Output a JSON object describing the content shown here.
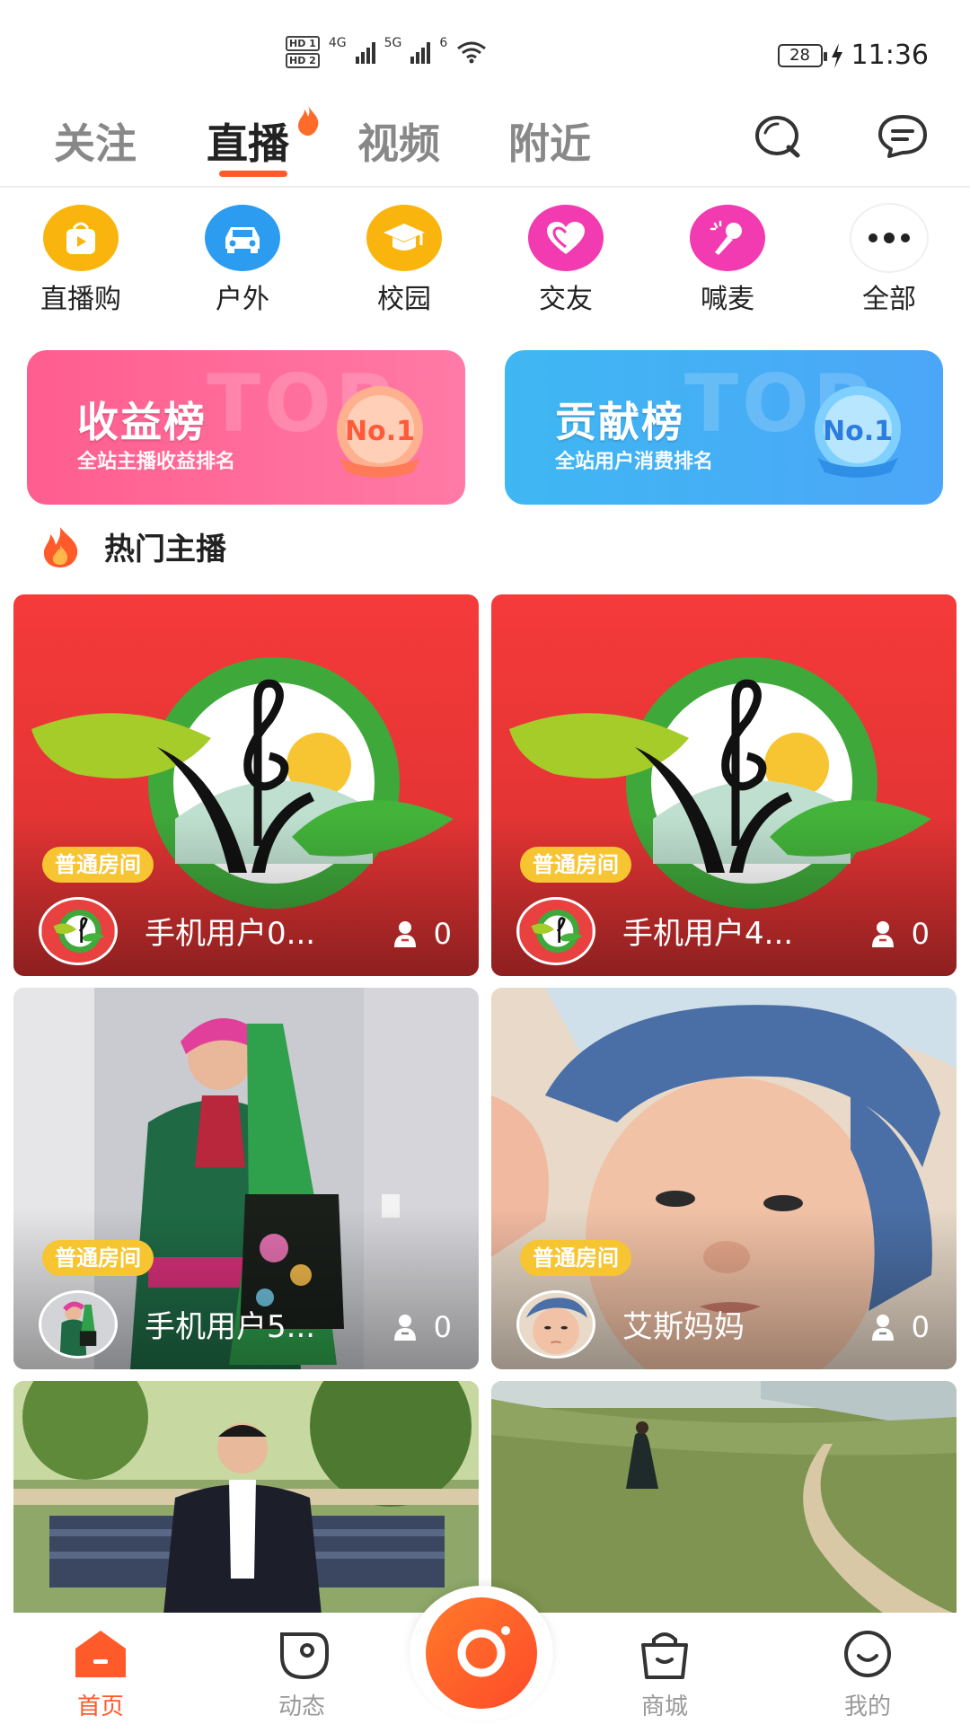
{
  "status_bar": {
    "hd1": "HD 1",
    "hd2": "HD 2",
    "net1": "4G",
    "net2": "5G",
    "wifi": "6",
    "battery": "28",
    "time": "11:36"
  },
  "top_tabs": [
    {
      "label": "关注",
      "active": false
    },
    {
      "label": "直播",
      "active": true
    },
    {
      "label": "视频",
      "active": false
    },
    {
      "label": "附近",
      "active": false
    }
  ],
  "top_icons": [
    "search-icon",
    "message-icon"
  ],
  "categories": [
    {
      "label": "直播购",
      "icon": "shopping-bag-play-icon",
      "color": "#f9b50d"
    },
    {
      "label": "户外",
      "icon": "car-icon",
      "color": "#2b9cf0"
    },
    {
      "label": "校园",
      "icon": "graduation-cap-icon",
      "color": "#f9b50d"
    },
    {
      "label": "交友",
      "icon": "heart-icon",
      "color": "#f23ab1"
    },
    {
      "label": "喊麦",
      "icon": "microphone-icon",
      "color": "#f23ab1"
    },
    {
      "label": "全部",
      "icon": "more-dots-icon",
      "color": "#ffffff"
    }
  ],
  "banners": [
    {
      "title": "收益榜",
      "subtitle": "全站主播收益排名",
      "bg": "TOP",
      "badge": "No.1"
    },
    {
      "title": "贡献榜",
      "subtitle": "全站用户消费排名",
      "bg": "TOP",
      "badge": "No.1"
    }
  ],
  "section": {
    "title": "热门主播"
  },
  "cards": [
    {
      "room": "普通房间",
      "name": "手机用户0...",
      "viewers": "0"
    },
    {
      "room": "普通房间",
      "name": "手机用户4...",
      "viewers": "0"
    },
    {
      "room": "普通房间",
      "name": "手机用户5...",
      "viewers": "0"
    },
    {
      "room": "普通房间",
      "name": "艾斯妈妈",
      "viewers": "0"
    }
  ],
  "bottom_nav": [
    {
      "label": "首页",
      "active": true
    },
    {
      "label": "动态",
      "active": false
    },
    {
      "label": "商城",
      "active": false
    },
    {
      "label": "我的",
      "active": false
    }
  ],
  "colors": {
    "accent": "#ff5a2a",
    "card_red": "#f23c3c",
    "room_tag": "#f7c531"
  }
}
